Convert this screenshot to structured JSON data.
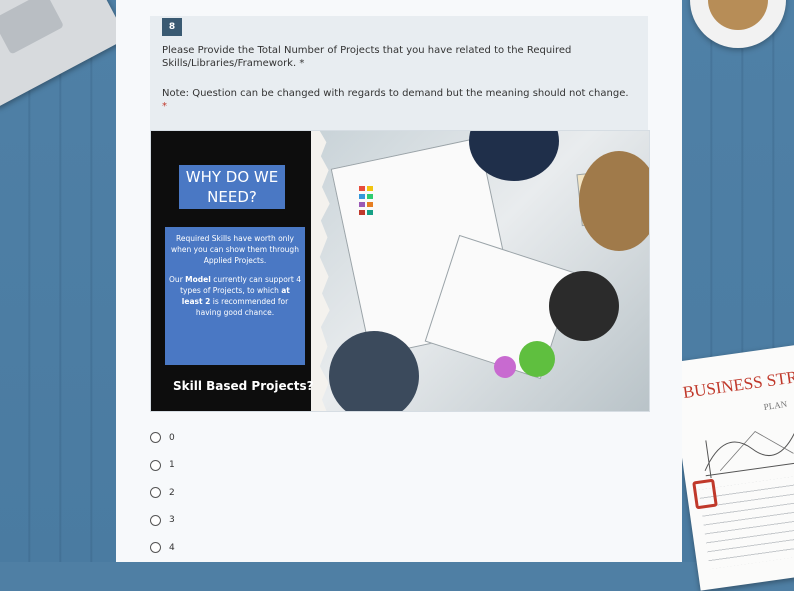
{
  "question": {
    "number": "8",
    "text": "Please Provide the Total Number of Projects that you have related to the Required Skills/Libraries/Framework. *",
    "note": "Note: Question can be changed with regards to demand but the meaning should not change.",
    "required_marker": "*"
  },
  "banner": {
    "heading": "WHY DO WE NEED?",
    "info_para1": "Required Skills have worth only when you can show them through Applied Projects.",
    "info_para2_prefix": "Our ",
    "info_para2_bold1": "Model",
    "info_para2_mid": " currently can support 4 types of Projects, to which ",
    "info_para2_bold2": "at least 2",
    "info_para2_suffix": " is recommended for having good chance.",
    "footer_question": "Skill Based Projects?"
  },
  "options": [
    "0",
    "1",
    "2",
    "3",
    "4"
  ],
  "decor": {
    "notebook_title": "BUSINESS STRAT",
    "notebook_sub": "PLAN"
  },
  "colors": {
    "background": "#4f7fa4",
    "panel": "#f7f9fb",
    "question_bg": "#e8edf1",
    "number_badge": "#3a5a72",
    "banner_blue": "#4a78c4"
  }
}
